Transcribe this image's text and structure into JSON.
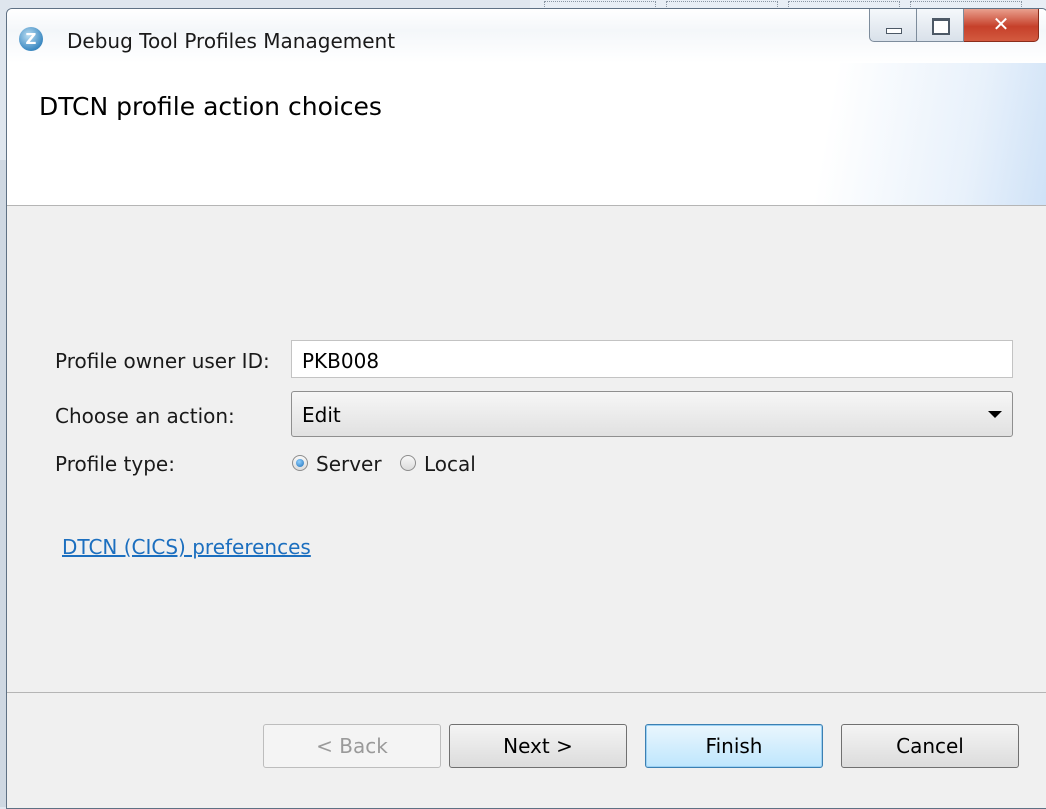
{
  "window": {
    "title": "Debug Tool Profiles Management",
    "icon": "debug-tool-app-icon",
    "caption_buttons": [
      "minimize-icon",
      "maximize-icon",
      "close-icon"
    ]
  },
  "banner": {
    "title": "DTCN profile action choices"
  },
  "form": {
    "owner_label": "Profile owner user ID:",
    "owner_value": "PKB008",
    "action_label": "Choose an action:",
    "action_value": "Edit",
    "profile_type_label": "Profile type:",
    "profile_type_options": [
      {
        "label": "Server",
        "selected": true
      },
      {
        "label": "Local",
        "selected": false
      }
    ],
    "preferences_link": "DTCN (CICS) preferences"
  },
  "buttons": {
    "back": "< Back",
    "next": "Next >",
    "finish": "Finish",
    "cancel": "Cancel"
  },
  "colors": {
    "link": "#1c6fbf",
    "close_button": "#c6402a"
  }
}
